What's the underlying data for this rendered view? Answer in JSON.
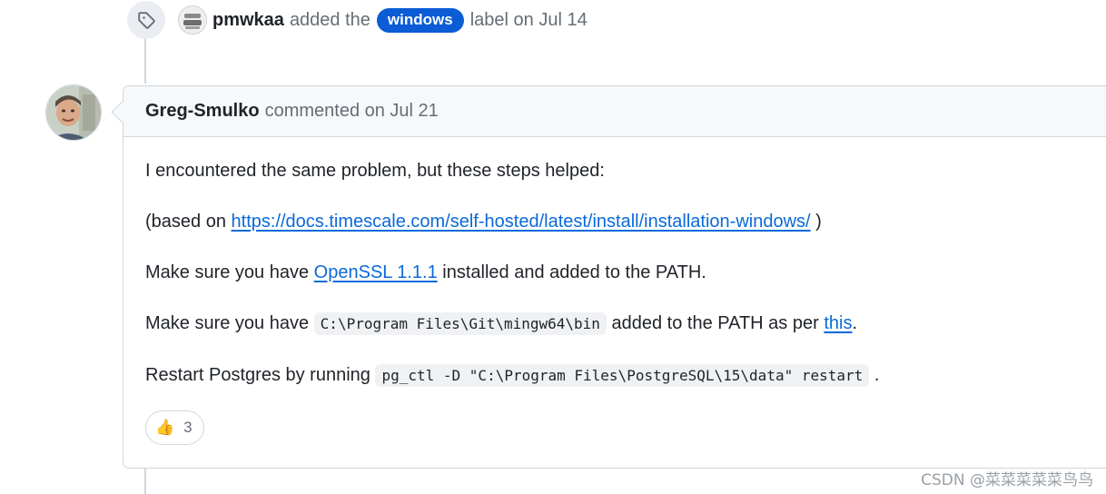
{
  "label_event": {
    "actor": "pmwkaa",
    "action": "added the",
    "label": "windows",
    "suffix": "label on Jul 14",
    "label_color": "#0b5cd5"
  },
  "comment": {
    "author": "Greg-Smulko",
    "meta": "commented on Jul 21",
    "paragraphs": {
      "p1": "I encountered the same problem, but these steps helped:",
      "p2_prefix": "(based on",
      "p2_link": "https://docs.timescale.com/self-hosted/latest/install/installation-windows/",
      "p2_suffix": ")",
      "p3_prefix": "Make sure you have",
      "p3_link": "OpenSSL 1.1.1",
      "p3_suffix": "installed and added to the PATH.",
      "p4_prefix": "Make sure you have",
      "p4_code": "C:\\Program Files\\Git\\mingw64\\bin",
      "p4_middle": "added to the PATH as per",
      "p4_link": "this",
      "p4_suffix": ".",
      "p5_prefix": "Restart Postgres by running",
      "p5_code": "pg_ctl -D \"C:\\Program Files\\PostgreSQL\\15\\data\" restart",
      "p5_suffix": "."
    },
    "reaction": {
      "emoji": "👍",
      "count": "3"
    }
  },
  "icons": {
    "label_event": "tag-icon",
    "reaction": "thumbs-up-icon"
  },
  "colors": {
    "link": "#0969da",
    "muted": "#656d76",
    "border": "#d0d7de"
  },
  "watermark": "CSDN @菜菜菜菜菜鸟鸟"
}
